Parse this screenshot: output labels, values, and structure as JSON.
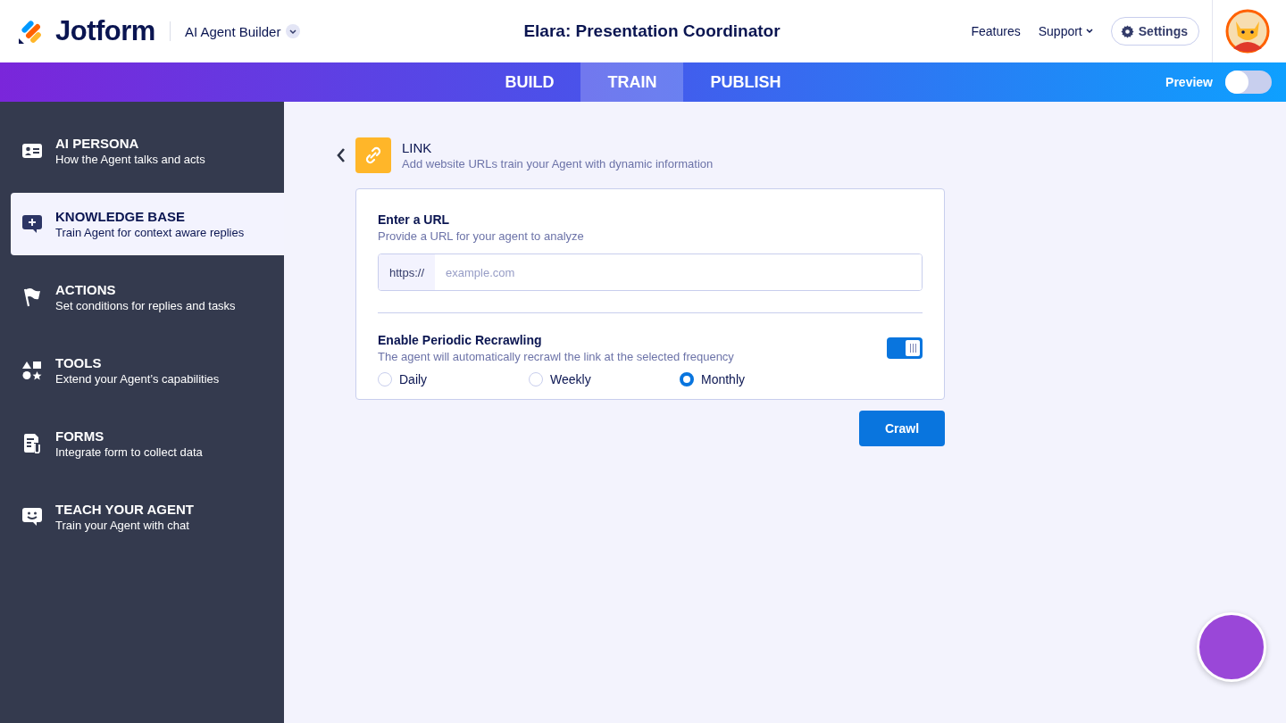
{
  "header": {
    "logo": "Jotform",
    "product": "AI Agent Builder",
    "title": "Elara: Presentation Coordinator",
    "links": [
      "Features",
      "Support"
    ],
    "settings": "Settings"
  },
  "tabs": [
    {
      "label": "BUILD",
      "selected": false
    },
    {
      "label": "TRAIN",
      "selected": true
    },
    {
      "label": "PUBLISH",
      "selected": false
    }
  ],
  "preview": {
    "label": "Preview",
    "on": false
  },
  "sidebar": {
    "items": [
      {
        "title": "AI PERSONA",
        "subtitle": "How the Agent talks and acts",
        "selected": false
      },
      {
        "title": "KNOWLEDGE BASE",
        "subtitle": "Train Agent for context aware replies",
        "selected": true
      },
      {
        "title": "ACTIONS",
        "subtitle": "Set conditions for replies and tasks",
        "selected": false
      },
      {
        "title": "TOOLS",
        "subtitle": "Extend your Agent’s capabilities",
        "selected": false
      },
      {
        "title": "FORMS",
        "subtitle": "Integrate form to collect data",
        "selected": false
      },
      {
        "title": "TEACH YOUR AGENT",
        "subtitle": "Train your Agent with chat",
        "selected": false
      }
    ]
  },
  "panel": {
    "title": "LINK",
    "subtitle": "Add website URLs train your Agent with dynamic information",
    "url": {
      "label": "Enter a URL",
      "hint": "Provide a URL for your agent to analyze",
      "prefix": "https://",
      "placeholder": "example.com"
    },
    "recrawl": {
      "label": "Enable Periodic Recrawling",
      "hint": "The agent will automatically recrawl the link at the selected frequency",
      "on": true,
      "options": [
        {
          "label": "Daily",
          "selected": false
        },
        {
          "label": "Weekly",
          "selected": false
        },
        {
          "label": "Monthly",
          "selected": true
        }
      ]
    },
    "button": "Crawl"
  }
}
